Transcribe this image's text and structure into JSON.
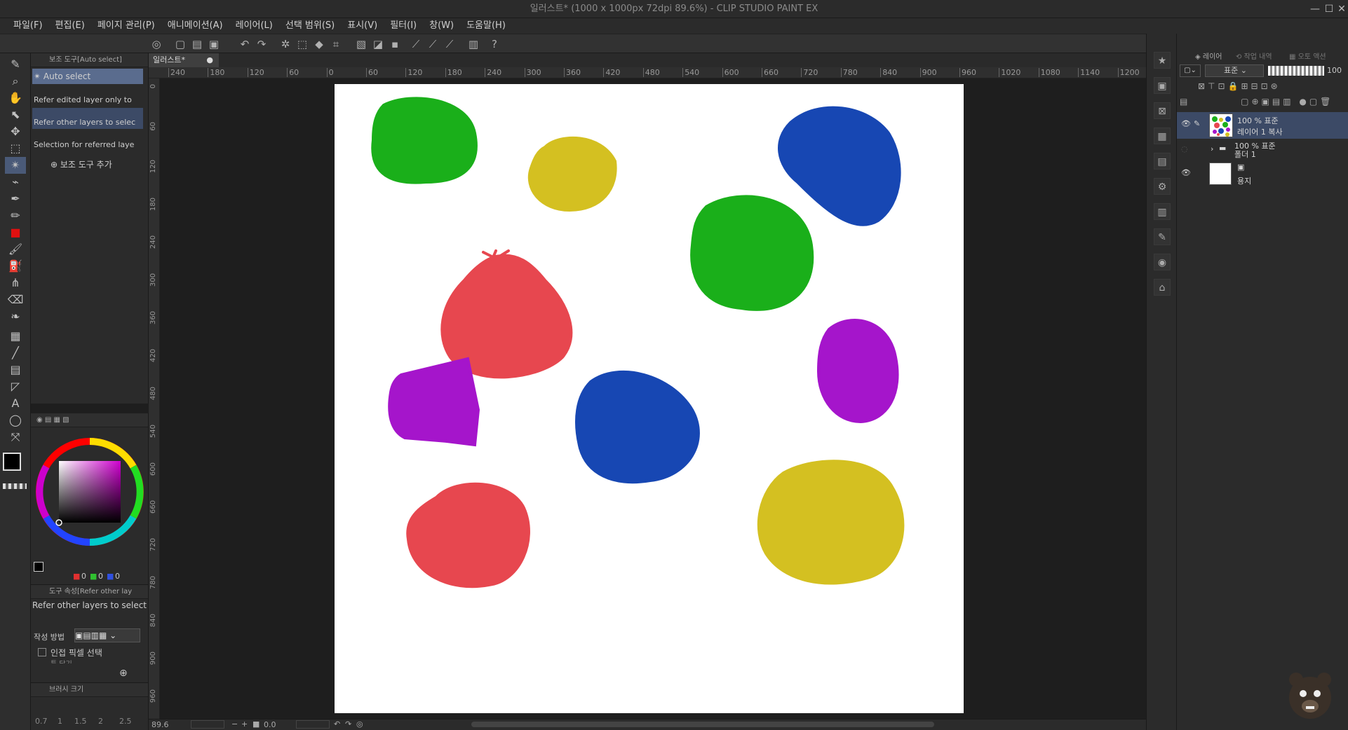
{
  "window": {
    "title": "일러스트* (1000 x 1000px 72dpi 89.6%)  - CLIP STUDIO PAINT EX",
    "controls": [
      "—",
      "☐",
      "✕"
    ]
  },
  "menu": [
    "파일(F)",
    "편집(E)",
    "페이지 관리(P)",
    "애니메이션(A)",
    "레이어(L)",
    "선택 범위(S)",
    "표시(V)",
    "필터(I)",
    "창(W)",
    "도움말(H)"
  ],
  "subtool_panel": {
    "header": "보조 도구[Auto select]",
    "items": [
      "Auto select",
      "Refer edited layer only to",
      "Refer other layers to selec",
      "Selection for referred laye"
    ],
    "add_label": "보조 도구 추가"
  },
  "document_tab": "일러스트*",
  "ruler_h": [
    "240",
    "180",
    "120",
    "60",
    "0",
    "60",
    "120",
    "180",
    "240",
    "300",
    "360",
    "420",
    "480",
    "540",
    "600",
    "660",
    "720",
    "780",
    "840",
    "900",
    "960",
    "1020",
    "1080",
    "1140",
    "1200",
    "12"
  ],
  "ruler_v": [
    "0",
    "60",
    "120",
    "180",
    "240",
    "300",
    "360",
    "420",
    "480",
    "540",
    "600",
    "660",
    "720",
    "780",
    "840",
    "900",
    "960"
  ],
  "color": {
    "r_label": "0",
    "g_label": "0",
    "b_label": "0",
    "main": "#000000",
    "sub": "#5a4a8a",
    "red_tool": "#e01010"
  },
  "tool_property": {
    "header": "도구 속성[Refer other lay",
    "subtitle": "Refer other layers to select",
    "mode_label": "작성 방법",
    "adjacent_label": "인접 픽셀 선택",
    "extra": "틈 닫기"
  },
  "brush_size": {
    "header": "브러시 크기",
    "values": [
      "0.7",
      "1",
      "1.5",
      "2",
      "2.5"
    ]
  },
  "status": {
    "zoom": "89.6",
    "angle": "0.0"
  },
  "layer_panel": {
    "tabs": [
      "레이어",
      "작업 내역",
      "오토 액션"
    ],
    "blend": "표준",
    "opacity": "100",
    "layers": [
      {
        "line1": "100 % 표준",
        "line2": "레이어 1 복사",
        "selected": true
      },
      {
        "line1": "100 % 표준",
        "line2": "폴더 1",
        "selected": false
      },
      {
        "line1": "",
        "line2": "용지",
        "selected": false
      }
    ]
  },
  "blobs": [
    {
      "color": "#1aaf1a"
    },
    {
      "color": "#d4c021"
    },
    {
      "color": "#1747b3"
    },
    {
      "color": "#e7474f"
    },
    {
      "color": "#1aaf1a"
    },
    {
      "color": "#a515cb"
    },
    {
      "color": "#1747b3"
    },
    {
      "color": "#a515cb"
    },
    {
      "color": "#e7474f"
    },
    {
      "color": "#d4c021"
    }
  ]
}
